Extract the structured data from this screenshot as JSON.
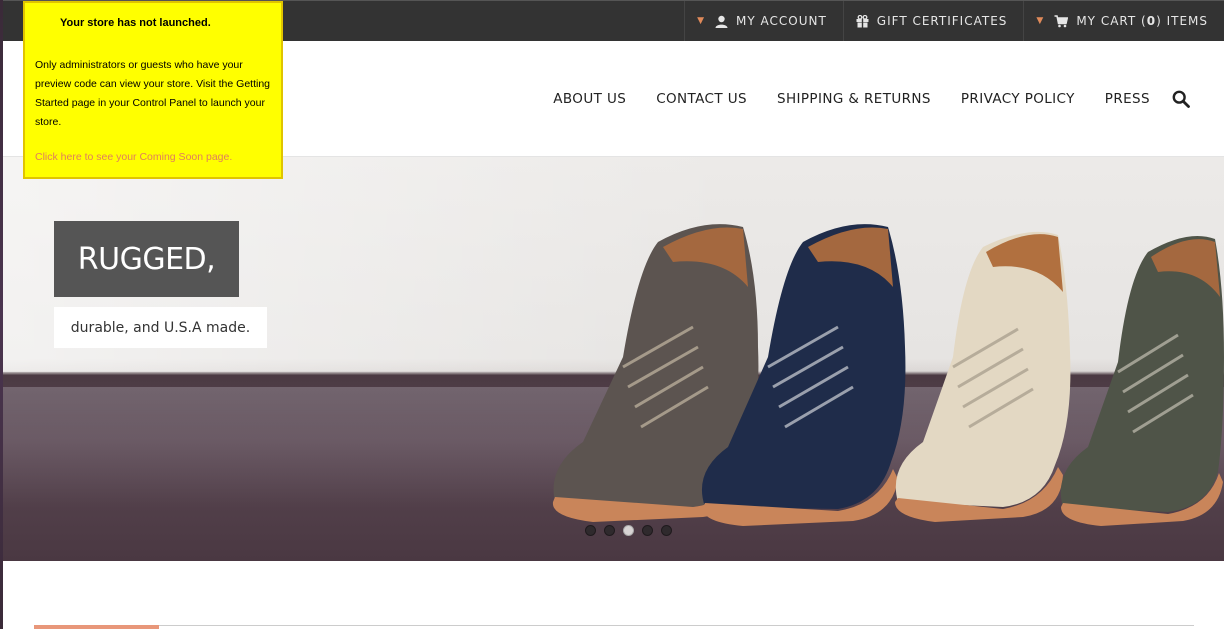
{
  "topbar": {
    "my_account": "MY ACCOUNT",
    "gift_certificates": "GIFT CERTIFICATES",
    "my_cart_prefix": "MY CART (",
    "cart_count": "0",
    "my_cart_suffix": ") ITEMS"
  },
  "nav": {
    "items": [
      "ABOUT US",
      "CONTACT US",
      "SHIPPING & RETURNS",
      "PRIVACY POLICY",
      "PRESS"
    ]
  },
  "hero": {
    "title": "RUGGED,",
    "subtitle": "durable, and U.S.A made.",
    "slide_count": 5,
    "active_slide": 3
  },
  "notice": {
    "title": "Your store has not launched.",
    "body": "Only administrators or guests who have your preview code can view your store. Visit the Getting Started page in your Control Panel to launch your store.",
    "link": "Click here to see your Coming Soon page."
  },
  "colors": {
    "topbar_bg": "#333333",
    "accent": "#e8977a",
    "notice_bg": "#ffff00",
    "title_box_bg": "#555555"
  },
  "icons": [
    "user-icon",
    "gift-icon",
    "cart-icon",
    "search-icon",
    "chevron-down-icon"
  ]
}
